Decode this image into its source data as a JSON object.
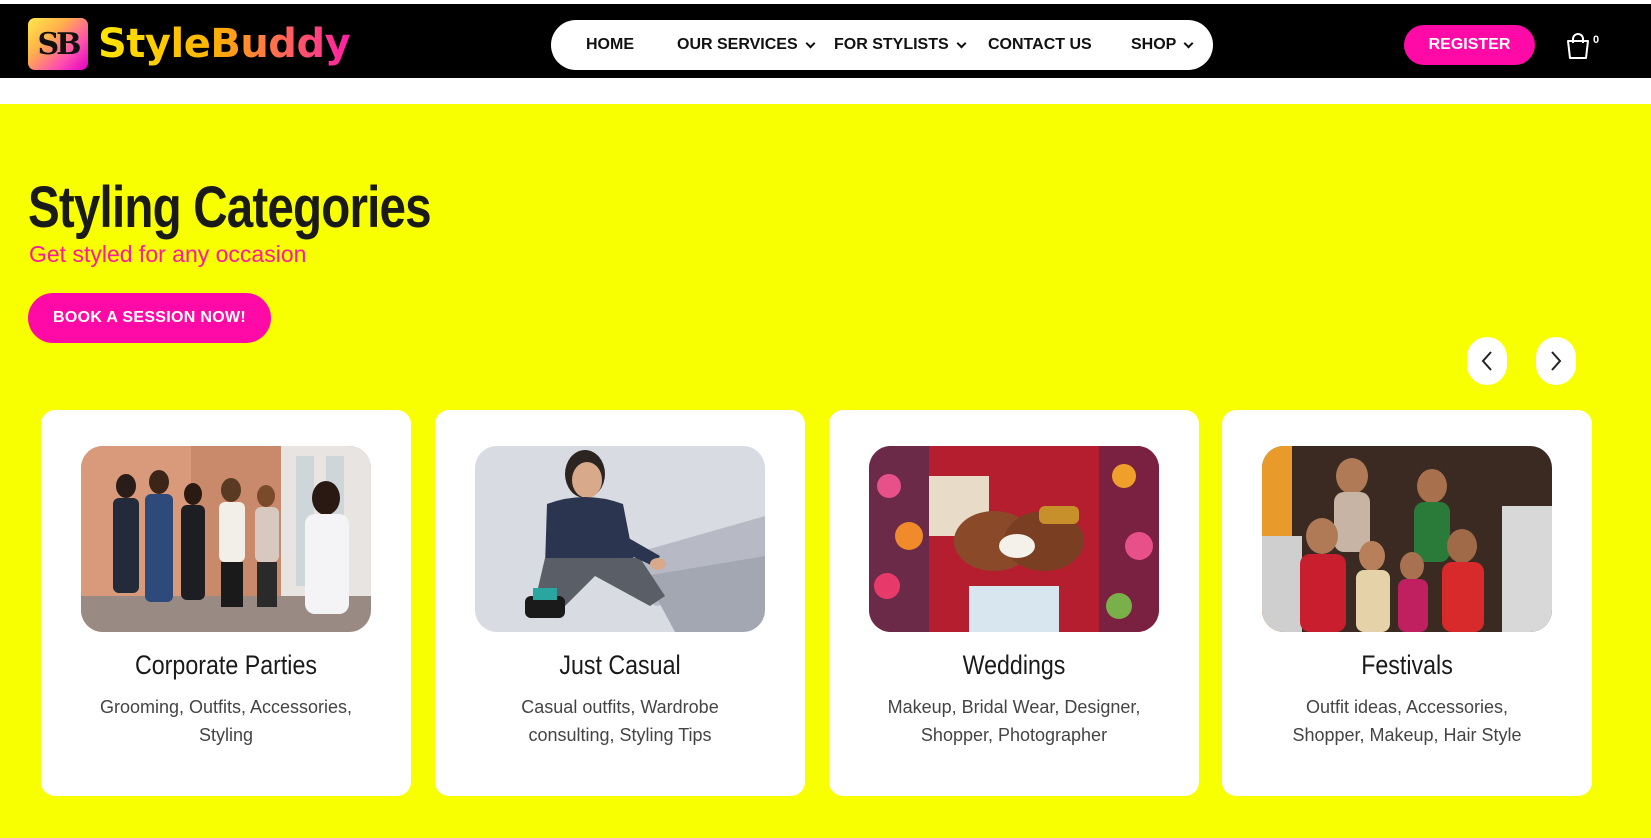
{
  "brand": {
    "logo_mark": "SB",
    "name": "StyleBuddy"
  },
  "nav": {
    "items": [
      {
        "label": "HOME",
        "has_dropdown": false
      },
      {
        "label": "OUR SERVICES",
        "has_dropdown": true
      },
      {
        "label": "FOR STYLISTS",
        "has_dropdown": true
      },
      {
        "label": "CONTACT US",
        "has_dropdown": false
      },
      {
        "label": "SHOP",
        "has_dropdown": true
      }
    ],
    "register_label": "REGISTER",
    "cart_icon": "shopping-bag-icon",
    "cart_count": "0"
  },
  "hero": {
    "title": "Styling Categories",
    "subtitle": "Get styled for any occasion",
    "cta_label": "BOOK A SESSION NOW!",
    "prev_icon": "chevron-left-icon",
    "next_icon": "chevron-right-icon"
  },
  "categories": [
    {
      "title": "Corporate Parties",
      "description": "Grooming, Outfits, Accessories, Styling",
      "image": "corporate-party-photo"
    },
    {
      "title": "Just Casual",
      "description": "Casual outfits, Wardrobe consulting, Styling Tips",
      "image": "casual-man-photo"
    },
    {
      "title": "Weddings",
      "description": "Makeup, Bridal Wear, Designer, Shopper, Photographer",
      "image": "wedding-hands-photo"
    },
    {
      "title": "Festivals",
      "description": "Outfit ideas, Accessories, Shopper, Makeup, Hair Style",
      "image": "festival-family-photo"
    }
  ],
  "colors": {
    "header_bg": "#000000",
    "accent_pink": "#ff0aa6",
    "hero_bg": "#f8ff00",
    "card_bg": "#ffffff"
  }
}
